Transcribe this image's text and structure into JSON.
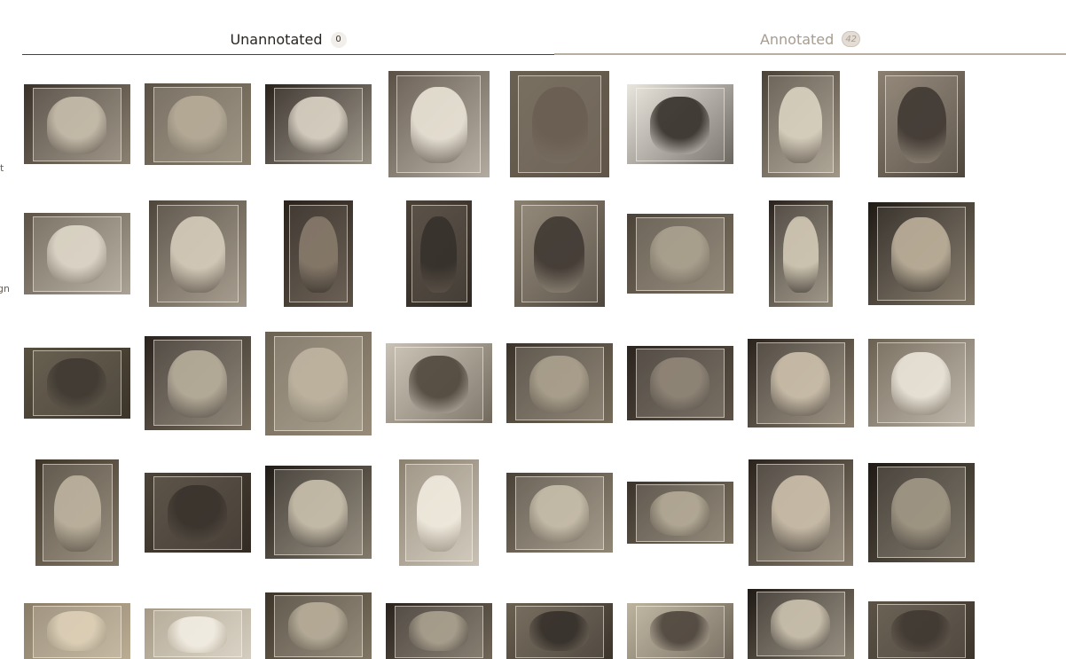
{
  "sidebar_fragments": [
    "lt",
    "gn"
  ],
  "tabs": {
    "unannotated": {
      "label": "Unannotated",
      "count": "0"
    },
    "annotated": {
      "label": "Annotated",
      "count": "42"
    }
  },
  "colors": {
    "active_text": "#2a241f",
    "inactive_text": "#a79c90",
    "photo_tone": "sepia"
  },
  "images": [
    {
      "subject": "dog",
      "tone": "#3a3129",
      "inner": "#bdb29f",
      "dark": false
    },
    {
      "subject": "dog",
      "tone": "#5b5246",
      "inner": "#a89c86",
      "dark": false
    },
    {
      "subject": "dog",
      "tone": "#2a231d",
      "inner": "#d8d1c2",
      "dark": true
    },
    {
      "subject": "dog",
      "tone": "#5a5045",
      "inner": "#e8e2d5",
      "dark": true
    },
    {
      "subject": "dog",
      "tone": "#6a6152",
      "inner": "#5a4d42",
      "dark": true
    },
    {
      "subject": "dog",
      "tone": "#e9e6de",
      "inner": "#1f1a15",
      "dark": true
    },
    {
      "subject": "dog",
      "tone": "#4a4137",
      "inner": "#d4cbb8",
      "dark": false
    },
    {
      "subject": "dog",
      "tone": "#8a7f70",
      "inner": "#2b241e",
      "dark": true
    },
    {
      "subject": "dog",
      "tone": "#5c5346",
      "inner": "#d9d2c3",
      "dark": false
    },
    {
      "subject": "dog",
      "tone": "#4e453b",
      "inner": "#d2c9b7",
      "dark": true
    },
    {
      "subject": "dog",
      "tone": "#2a231d",
      "inner": "#7a6d5d",
      "dark": true
    },
    {
      "subject": "dog",
      "tone": "#4a4137",
      "inner": "#1f1a15",
      "dark": true
    },
    {
      "subject": "dog",
      "tone": "#8a8070",
      "inner": "#2b241e",
      "dark": true
    },
    {
      "subject": "dog",
      "tone": "#4c4338",
      "inner": "#9a8f7c",
      "dark": false
    },
    {
      "subject": "dog",
      "tone": "#2a231d",
      "inner": "#c9bfa9",
      "dark": false
    },
    {
      "subject": "dog",
      "tone": "#1f1a15",
      "inner": "#b7aa93",
      "dark": true
    },
    {
      "subject": "dog",
      "tone": "#58503f",
      "inner": "#2a241e",
      "dark": true
    },
    {
      "subject": "cat",
      "tone": "#2a231d",
      "inner": "#a99e8a",
      "dark": false
    },
    {
      "subject": "dog",
      "tone": "#6b6152",
      "inner": "#b2a690",
      "dark": false
    },
    {
      "subject": "dog",
      "tone": "#c9c2b4",
      "inner": "#3d3429",
      "dark": true
    },
    {
      "subject": "dog",
      "tone": "#3b332a",
      "inner": "#9b8f7a",
      "dark": false
    },
    {
      "subject": "cat",
      "tone": "#2c251f",
      "inner": "#7a6e5f",
      "dark": false
    },
    {
      "subject": "cat",
      "tone": "#2a231d",
      "inner": "#c3b59e",
      "dark": false
    },
    {
      "subject": "cat",
      "tone": "#6b6152",
      "inner": "#eae5da",
      "dark": true
    },
    {
      "subject": "cat",
      "tone": "#3d3429",
      "inner": "#b1a58f",
      "dark": false
    },
    {
      "subject": "cat",
      "tone": "#4c4338",
      "inner": "#231d17",
      "dark": true
    },
    {
      "subject": "cat",
      "tone": "#1f1a15",
      "inner": "#bfb49f",
      "dark": false
    },
    {
      "subject": "cat",
      "tone": "#8a8070",
      "inner": "#efe9dd",
      "dark": false
    },
    {
      "subject": "cat",
      "tone": "#4a4137",
      "inner": "#bdb29d",
      "dark": false
    },
    {
      "subject": "cat",
      "tone": "#3b332a",
      "inner": "#a59a84",
      "dark": false
    },
    {
      "subject": "cat",
      "tone": "#2a231d",
      "inner": "#c2b49d",
      "dark": false
    },
    {
      "subject": "cat",
      "tone": "#1f1a15",
      "inner": "#8f8470",
      "dark": false
    },
    {
      "subject": "cat",
      "tone": "#8a7d68",
      "inner": "#d8c9ad",
      "dark": false
    },
    {
      "subject": "cat",
      "tone": "#a59a86",
      "inner": "#f1ece2",
      "dark": false
    },
    {
      "subject": "cat",
      "tone": "#3d3429",
      "inner": "#a99e88",
      "dark": false
    },
    {
      "subject": "cat",
      "tone": "#2a231d",
      "inner": "#9a8f7c",
      "dark": false
    },
    {
      "subject": "cat",
      "tone": "#6b6152",
      "inner": "#1f1a15",
      "dark": true
    },
    {
      "subject": "cat",
      "tone": "#bdb49f",
      "inner": "#3a3129",
      "dark": true
    },
    {
      "subject": "cat",
      "tone": "#1f1a15",
      "inner": "#c2b7a2",
      "dark": false
    },
    {
      "subject": "cat",
      "tone": "#5c5346",
      "inner": "#2a231d",
      "dark": true
    }
  ]
}
